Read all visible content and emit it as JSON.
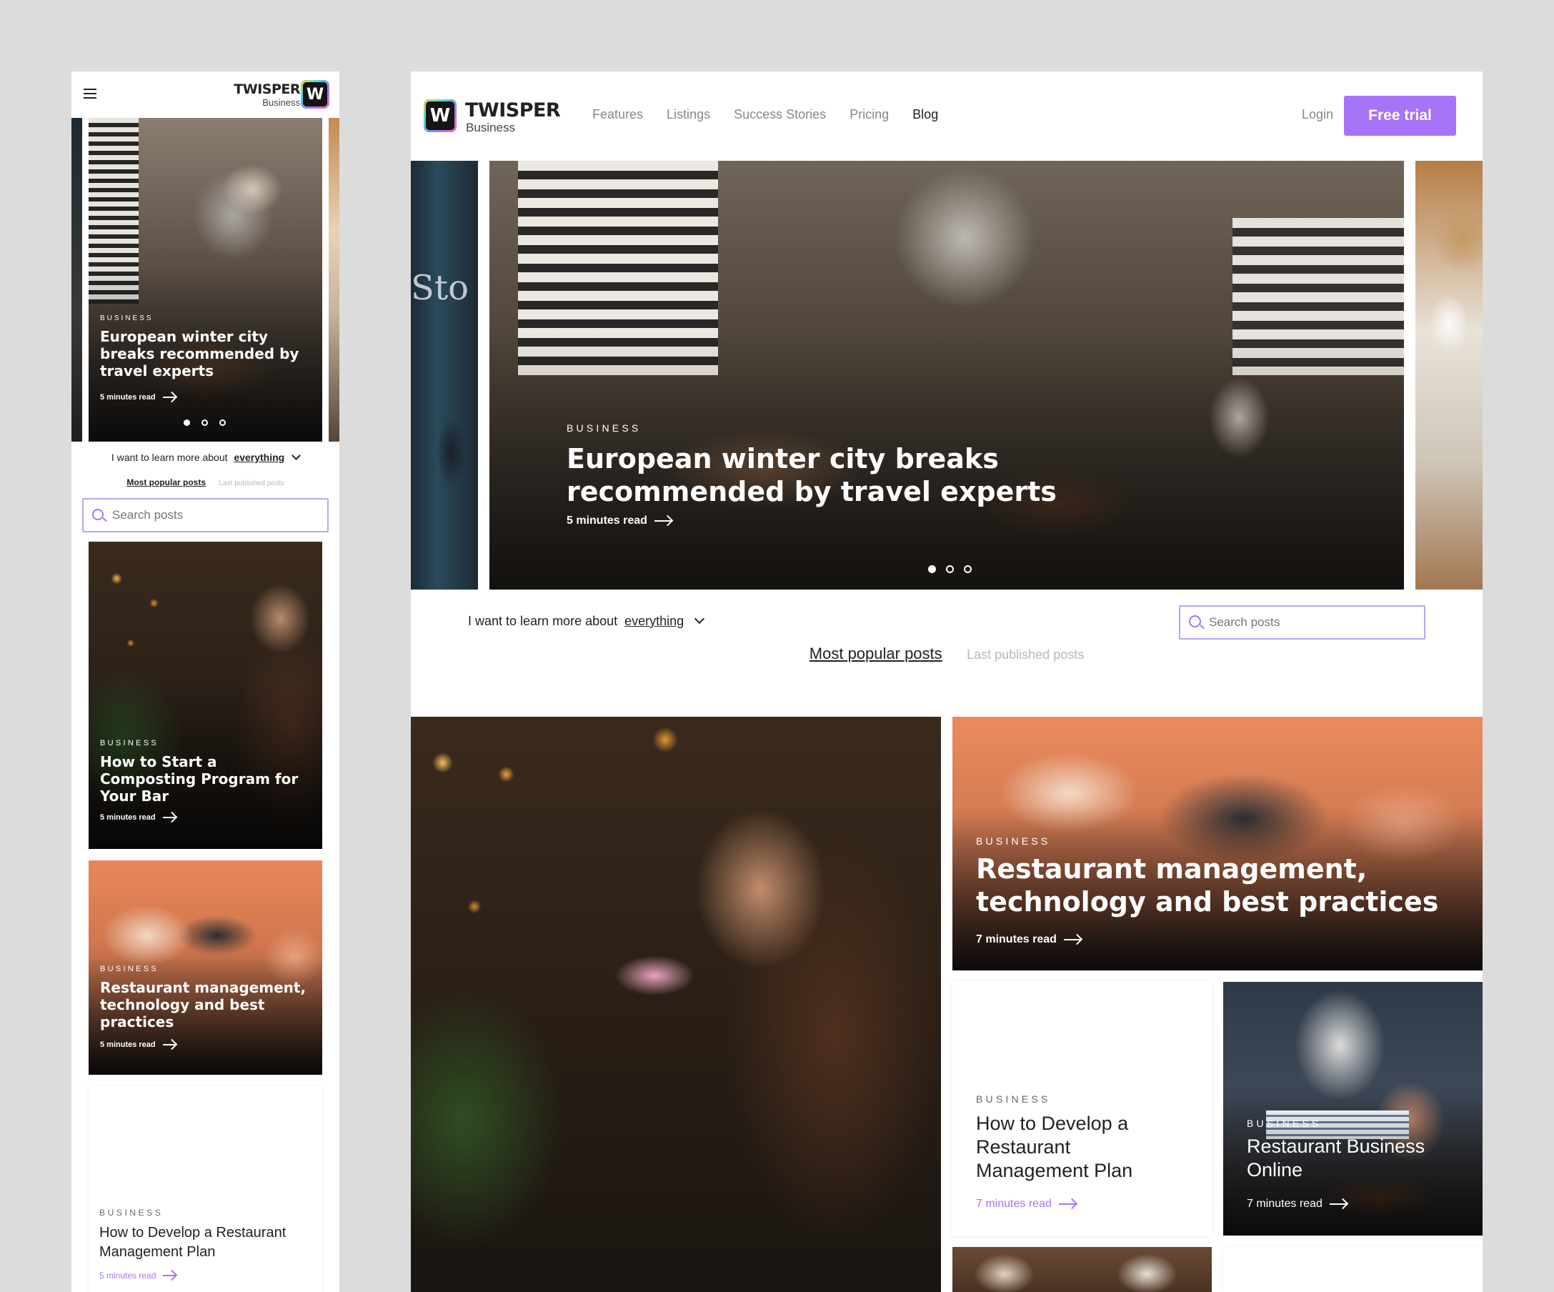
{
  "brand": {
    "name": "TWISPER",
    "sub": "Business",
    "mark": "W"
  },
  "colors": {
    "accent": "#a773f8",
    "text_dark": "#222222",
    "text_muted": "#8a8a8a",
    "text_faint": "#b8b8b8",
    "background": "#dcdcdc"
  },
  "nav": {
    "items": [
      {
        "label": "Features"
      },
      {
        "label": "Listings"
      },
      {
        "label": "Success Stories"
      },
      {
        "label": "Pricing"
      },
      {
        "label": "Blog"
      }
    ],
    "login": "Login",
    "cta": "Free trial"
  },
  "hero": {
    "category": "BUSINESS",
    "title": "European winter city breaks recommended by travel experts",
    "read_time": "5 minutes read",
    "slides_total": 3,
    "active_slide": 1
  },
  "filter": {
    "prefix": "I want to learn more about",
    "topic": "everything",
    "tabs": [
      {
        "label": "Most popular posts",
        "active": true
      },
      {
        "label": "Last published posts",
        "active": false
      }
    ],
    "search_placeholder": "Search posts"
  },
  "posts": [
    {
      "category": "BUSINESS",
      "title": "How to Start a Composting Program for Your Bar",
      "read_time": "5 minutes read"
    },
    {
      "category": "BUSINESS",
      "title": "Restaurant management, technology and best practices",
      "read_time": "7 minutes read"
    },
    {
      "category": "BUSINESS",
      "title": "How to Develop a Restaurant Management Plan",
      "read_time": "7 minutes read"
    },
    {
      "category": "BUSINESS",
      "title": "Restaurant Business Online",
      "read_time": "7 minutes read"
    }
  ],
  "mobile": {
    "read_time": "5 minutes read"
  },
  "icons": {
    "menu": "hamburger-menu-icon",
    "search": "search-icon",
    "chevron": "chevron-down-icon",
    "arrow": "arrow-right-icon"
  }
}
